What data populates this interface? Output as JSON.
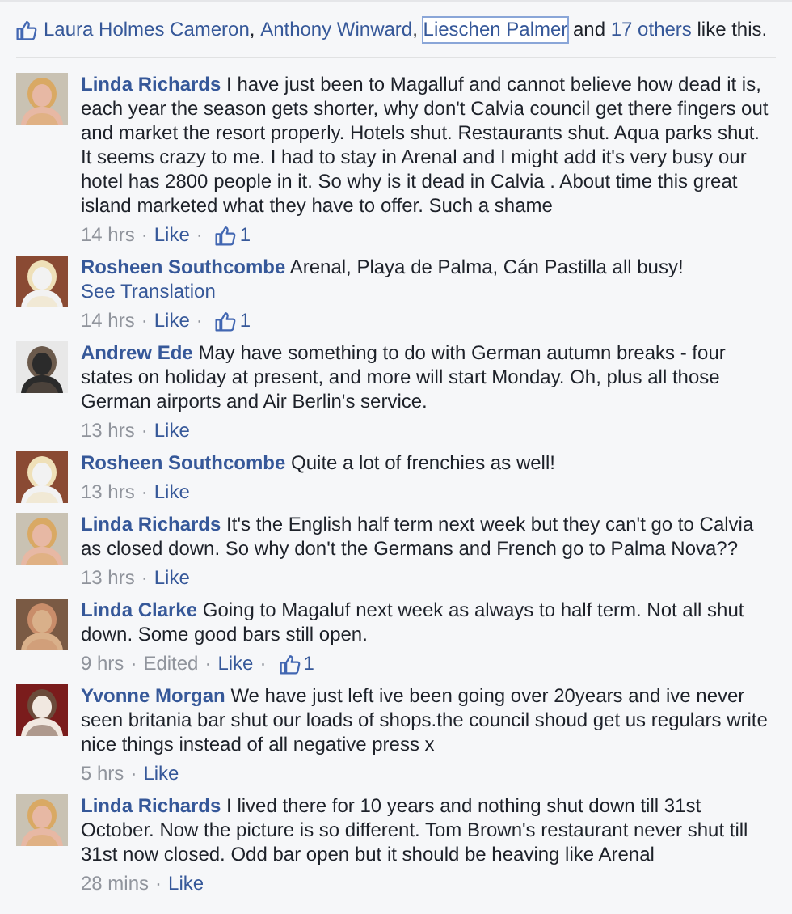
{
  "likes": {
    "names": [
      {
        "name": "Laura Holmes Cameron",
        "focused": false
      },
      {
        "name": "Anthony Winward",
        "focused": false
      },
      {
        "name": "Lieschen Palmer",
        "focused": true
      }
    ],
    "comma": ",",
    "joiner": "and",
    "others": "17 others",
    "suffix": "like this."
  },
  "separator": "·",
  "comments": [
    {
      "author": "Linda Richards",
      "text": "I have just been to Magalluf and cannot believe how dead it is, each year the season gets shorter, why don't Calvia council get there fingers out and market the resort properly. Hotels shut. Restaurants shut. Aqua parks shut. It seems crazy to me. I had to stay in Arenal and I might add it's very busy our hotel has 2800 people in it. So why is it dead in Calvia . About time this great island marketed what they have to offer. Such a shame",
      "time": "14 hrs",
      "like": "Like",
      "like_count": "1"
    },
    {
      "author": "Rosheen Southcombe",
      "text": "Arenal, Playa de Palma, Cán Pastilla all busy!",
      "translation": "See Translation",
      "time": "14 hrs",
      "like": "Like",
      "like_count": "1"
    },
    {
      "author": "Andrew Ede",
      "text": "May have something to do with German autumn breaks - four states on holiday at present, and more will start Monday. Oh, plus all those German airports and Air Berlin's service.",
      "time": "13 hrs",
      "like": "Like"
    },
    {
      "author": "Rosheen Southcombe",
      "text": "Quite a lot of frenchies as well!",
      "time": "13 hrs",
      "like": "Like"
    },
    {
      "author": "Linda Richards",
      "text": "It's the English half term next week but they can't go to Calvia as closed down. So why don't the Germans and French go to Palma Nova??",
      "time": "13 hrs",
      "like": "Like"
    },
    {
      "author": "Linda Clarke",
      "text": "Going to Magaluf next week as always to half term. Not all shut down. Some good bars still open.",
      "time": "9 hrs",
      "edited": "Edited",
      "like": "Like",
      "like_count": "1"
    },
    {
      "author": "Yvonne Morgan",
      "text": "We have just left ive been going over 20years and ive never seen britania bar shut our loads of shops.the council shoud get us regulars write nice things instead of all negative press x",
      "time": "5 hrs",
      "like": "Like"
    },
    {
      "author": "Linda Richards",
      "text": "I lived there for 10 years and nothing shut down till 31st October. Now the picture is so different. Tom Brown's restaurant never shut till 31st now closed. Odd bar open but it should be heaving like Arenal",
      "time": "28 mins",
      "like": "Like"
    }
  ]
}
